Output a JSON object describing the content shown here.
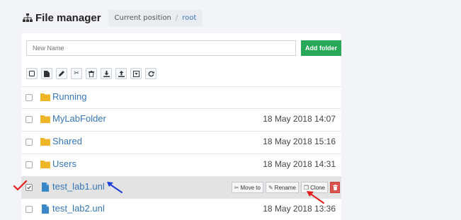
{
  "header": {
    "title": "File manager",
    "breadcrumb_label": "Current position",
    "breadcrumb_sep": "/",
    "breadcrumb_root": "root"
  },
  "new_folder": {
    "placeholder": "New Name",
    "button_label": "Add folder"
  },
  "toolbar": {
    "icons": [
      "select-all-icon",
      "new-file-icon",
      "edit-icon",
      "cut-icon",
      "delete-icon",
      "download-icon",
      "upload-icon",
      "import-icon",
      "refresh-icon"
    ]
  },
  "rows": [
    {
      "type": "folder",
      "name": "Running",
      "date": ""
    },
    {
      "type": "folder",
      "name": "MyLabFolder",
      "date": "18 May 2018 14:07"
    },
    {
      "type": "folder",
      "name": "Shared",
      "date": "18 May 2018 15:16"
    },
    {
      "type": "folder",
      "name": "Users",
      "date": "18 May 2018 14:31"
    },
    {
      "type": "file",
      "name": "test_lab1.unl",
      "date": "",
      "selected": true
    },
    {
      "type": "file",
      "name": "test_lab2.unl",
      "date": "18 May 2018 13:36"
    }
  ],
  "row_actions": {
    "move_label": "Move to",
    "rename_label": "Rename",
    "clone_label": "Clone"
  },
  "colors": {
    "link": "#3576b8",
    "folder": "#f0b429",
    "file": "#3a87c8",
    "add_button": "#27a957",
    "delete_button": "#d9534f",
    "annotation_red": "#e0201c",
    "annotation_blue": "#1a3fd6"
  }
}
